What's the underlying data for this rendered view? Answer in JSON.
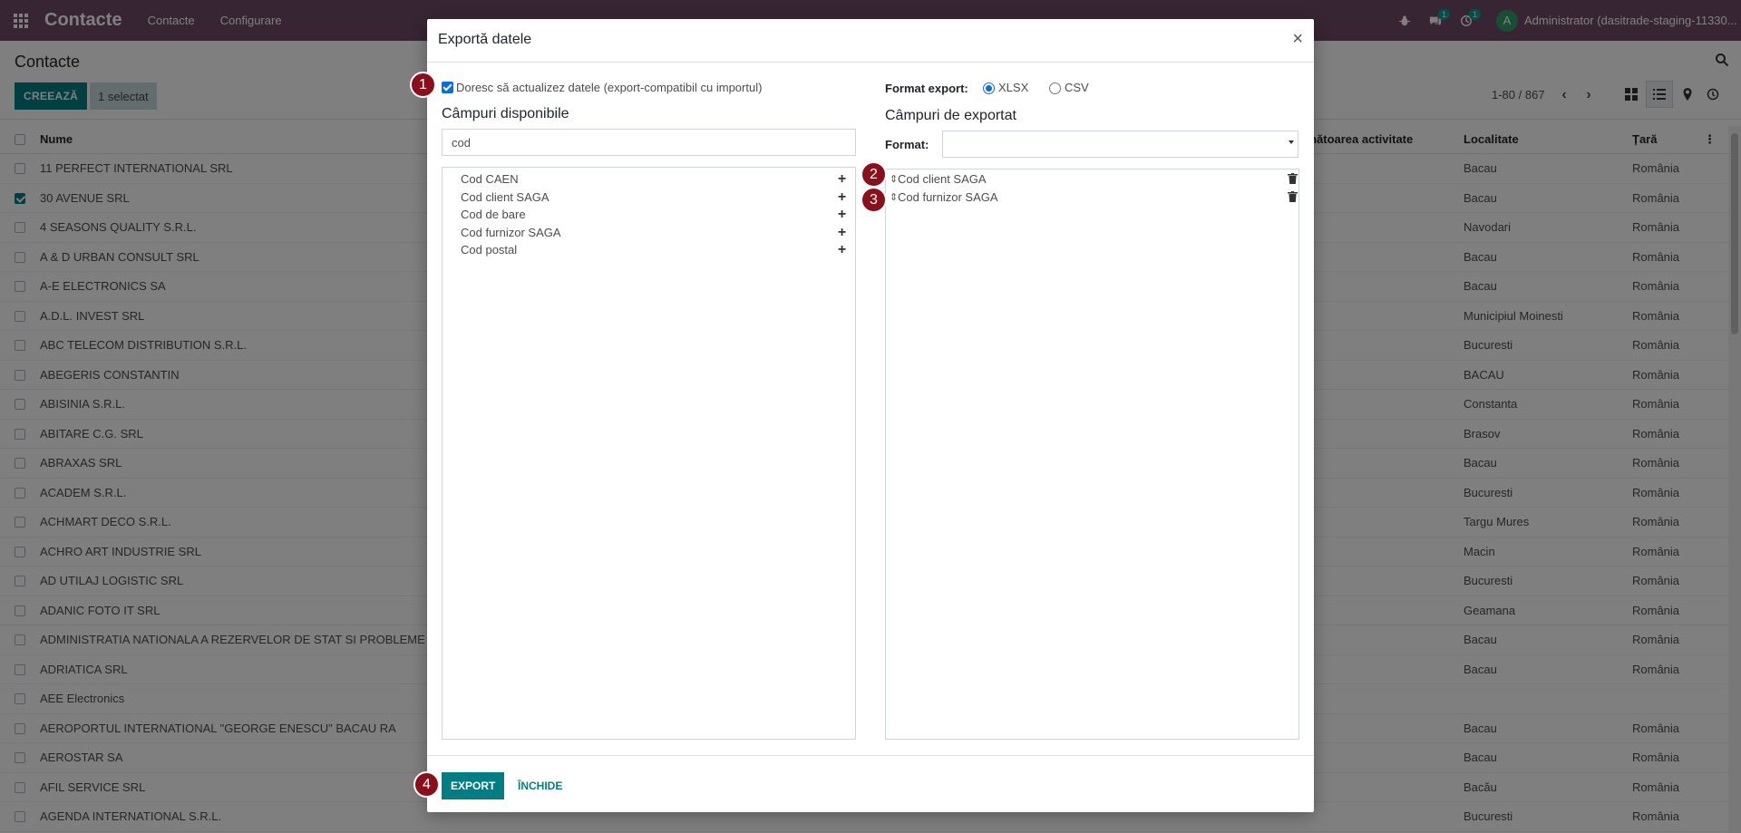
{
  "navbar": {
    "app_title": "Contacte",
    "menus": [
      "Contacte",
      "Configurare"
    ],
    "messages_badge": "1",
    "activities_badge": "1",
    "user_initial": "A",
    "user_name": "Administrator (dasitrade-staging-11330..."
  },
  "control_panel": {
    "breadcrumb": "Contacte",
    "create_label": "CREEAZĂ",
    "selected_label": "1 selectat",
    "pager": "1-80 / 867"
  },
  "list": {
    "columns": {
      "name": "Nume",
      "activity": "Următoarea activitate",
      "city": "Localitate",
      "country": "Țară"
    },
    "rows": [
      {
        "name": "11 PERFECT INTERNATIONAL SRL",
        "city": "Bacau",
        "country": "România",
        "checked": false
      },
      {
        "name": "30 AVENUE SRL",
        "city": "Bacau",
        "country": "România",
        "checked": true
      },
      {
        "name": "4 SEASONS QUALITY S.R.L.",
        "city": "Navodari",
        "country": "România",
        "checked": false
      },
      {
        "name": "A & D URBAN CONSULT SRL",
        "city": "Bacau",
        "country": "România",
        "checked": false
      },
      {
        "name": "A-E ELECTRONICS SA",
        "city": "Bacau",
        "country": "România",
        "checked": false
      },
      {
        "name": "A.D.L. INVEST SRL",
        "city": "Municipiul Moinesti",
        "country": "România",
        "checked": false
      },
      {
        "name": "ABC TELECOM DISTRIBUTION S.R.L.",
        "city": "Bucuresti",
        "country": "România",
        "checked": false
      },
      {
        "name": "ABEGERIS CONSTANTIN",
        "city": "BACAU",
        "country": "România",
        "checked": false
      },
      {
        "name": "ABISINIA S.R.L.",
        "city": "Constanta",
        "country": "România",
        "checked": false
      },
      {
        "name": "ABITARE C.G. SRL",
        "city": "Brasov",
        "country": "România",
        "checked": false
      },
      {
        "name": "ABRAXAS SRL",
        "city": "Bacau",
        "country": "România",
        "checked": false
      },
      {
        "name": "ACADEM S.R.L.",
        "city": "Bucuresti",
        "country": "România",
        "checked": false
      },
      {
        "name": "ACHMART DECO S.R.L.",
        "city": "Targu Mures",
        "country": "România",
        "checked": false
      },
      {
        "name": "ACHRO ART INDUSTRIE SRL",
        "city": "Macin",
        "country": "România",
        "checked": false
      },
      {
        "name": "AD UTILAJ LOGISTIC SRL",
        "city": "Bucuresti",
        "country": "România",
        "checked": false
      },
      {
        "name": "ADANIC FOTO IT SRL",
        "city": "Geamana",
        "country": "România",
        "checked": false
      },
      {
        "name": "ADMINISTRATIA NATIONALA A REZERVELOR DE STAT SI PROBLEME SPECIALE",
        "city": "Bacau",
        "country": "România",
        "checked": false
      },
      {
        "name": "ADRIATICA SRL",
        "city": "Bacau",
        "country": "România",
        "checked": false
      },
      {
        "name": "AEE Electronics",
        "city": "",
        "country": "",
        "checked": false
      },
      {
        "name": "AEROPORTUL INTERNATIONAL \"GEORGE ENESCU\" BACAU RA",
        "city": "Bacau",
        "country": "România",
        "checked": false
      },
      {
        "name": "AEROSTAR SA",
        "city": "Bacau",
        "country": "România",
        "checked": false
      },
      {
        "name": "AFIL SERVICE SRL",
        "city": "Bacău",
        "country": "România",
        "checked": false
      },
      {
        "name": "AGENDA INTERNATIONAL S.R.L.",
        "city": "Bucuresti",
        "country": "România",
        "checked": false
      }
    ]
  },
  "modal": {
    "title": "Exportă datele",
    "close_glyph": "×",
    "compat_label": "Doresc să actualizez datele (export-compatibil cu importul)",
    "available_title": "Câmpuri disponibile",
    "search_value": "cod",
    "available_fields": [
      "Cod CAEN",
      "Cod client SAGA",
      "Cod de bare",
      "Cod furnizor SAGA",
      "Cod postal"
    ],
    "export_format_label": "Format export:",
    "formats": [
      "XLSX",
      "CSV"
    ],
    "selected_format": "XLSX",
    "export_title": "Câmpuri de exportat",
    "template_label": "Format:",
    "template_value": "",
    "export_fields": [
      "Cod client SAGA",
      "Cod furnizor SAGA"
    ],
    "export_button": "EXPORT",
    "close_button": "ÎNCHIDE"
  },
  "steps": [
    "1",
    "2",
    "3",
    "4"
  ],
  "colors": {
    "navbar": "#714b67",
    "primary": "#017e84",
    "step_badge": "#8b0f1a"
  }
}
